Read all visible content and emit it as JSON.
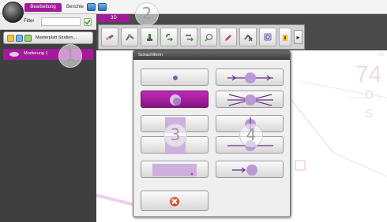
{
  "ribbon": {
    "tab_active": "Bearbeitung",
    "tab_inactive": "Berichte"
  },
  "filter": {
    "label": "Filter",
    "value": ""
  },
  "sidebar": {
    "header_label": "Masterplatt Studien...",
    "item_label": "Modierung 1"
  },
  "subtab": {
    "label": "3D"
  },
  "toolbar": {
    "next_label": "▸"
  },
  "dialog": {
    "title": "Schachtform",
    "close_label": ""
  },
  "background": {
    "big_number": "74",
    "letters": [
      "D",
      "S"
    ],
    "fragment": "So"
  },
  "callouts": [
    "1",
    "2",
    "3",
    "4"
  ],
  "colors": {
    "accent": "#a21b9b",
    "dark_panel": "#3f3f3f",
    "toolbar": "#d2d2d2"
  }
}
